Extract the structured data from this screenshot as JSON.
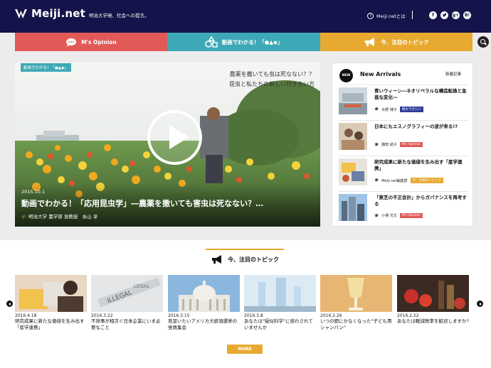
{
  "header": {
    "logo_text": "Meiji.net",
    "tagline": "明治大学発、社会への提言。",
    "about_label": "Meiji.netとは",
    "social_icons": [
      "facebook-icon",
      "twitter-icon",
      "google-plus-icon",
      "hatena-bookmark-icon"
    ],
    "google_plus_label": "g+",
    "hatena_label": "B!"
  },
  "nav": {
    "items": [
      {
        "label": "M's Opinion",
        "color": "#e25a58",
        "icon": "speech-bubble-icon"
      },
      {
        "label": "動画でわかる！「●▲◆」",
        "color": "#3ea9b6",
        "icon": "shapes-icon"
      },
      {
        "label": "今、注目のトピック",
        "color": "#e7a92f",
        "icon": "megaphone-icon"
      }
    ]
  },
  "feature": {
    "category": "動画でわかる！「●▲◆」",
    "copy_line1": "農薬を撒いても虫は死なない？？",
    "copy_line2": "昆虫と私たちの新しい付き合い方",
    "date": "2015.10.1",
    "title": "動画でわかる！「応用昆虫学」―農薬を撒いても害虫は死なない？…",
    "author": "明治大学 農学部 准教授　糸山 享"
  },
  "new_arrivals": {
    "title": "New Arrivals",
    "badge": "NEW",
    "label": "新着記事",
    "items": [
      {
        "headline": "青いウィーン―ネオリベラルな構造転換と急進な変化―",
        "author": "水野 博子",
        "tag": "明大マガジン",
        "tag_color": "#2d3d9a"
      },
      {
        "headline": "日本にもエスノグラフィーの波が来る!?",
        "author": "藤田 結子",
        "tag": "M's Opinion",
        "tag_color": "#e25a58"
      },
      {
        "headline": "研究成果に新たな価値を生み出す「産学連携」",
        "author": "Meiji.net編集部",
        "tag": "今、注目のトピック",
        "tag_color": "#e7a92f"
      },
      {
        "headline": "「東芝の不正会計」からガバナンスを再考する",
        "author": "小俣 光文",
        "tag": "M's Opinion",
        "tag_color": "#e25a58"
      }
    ]
  },
  "topics": {
    "title": "今、注目のトピック",
    "more_label": "MORE",
    "items": [
      {
        "date": "2016.4.18",
        "text": "研究成果に新たな価値を生み出す「産学連携」"
      },
      {
        "date": "2016.3.22",
        "text": "不祥事が相次ぐ日本企業にいま必要なこと"
      },
      {
        "date": "2016.3.15",
        "text": "見習いたいアメリカ大統領選挙の党員集会"
      },
      {
        "date": "2016.3.8",
        "text": "あなたは\"疑似科学\"に惑わされていませんか"
      },
      {
        "date": "2016.2.26",
        "text": "いつの間にかなくなった\"子ども用シャンパン\""
      },
      {
        "date": "2016.2.22",
        "text": "あなたは軽減税率を歓迎しますか?"
      }
    ],
    "thumb_words": [
      "ILLEGAL",
      "LEGAL"
    ]
  }
}
